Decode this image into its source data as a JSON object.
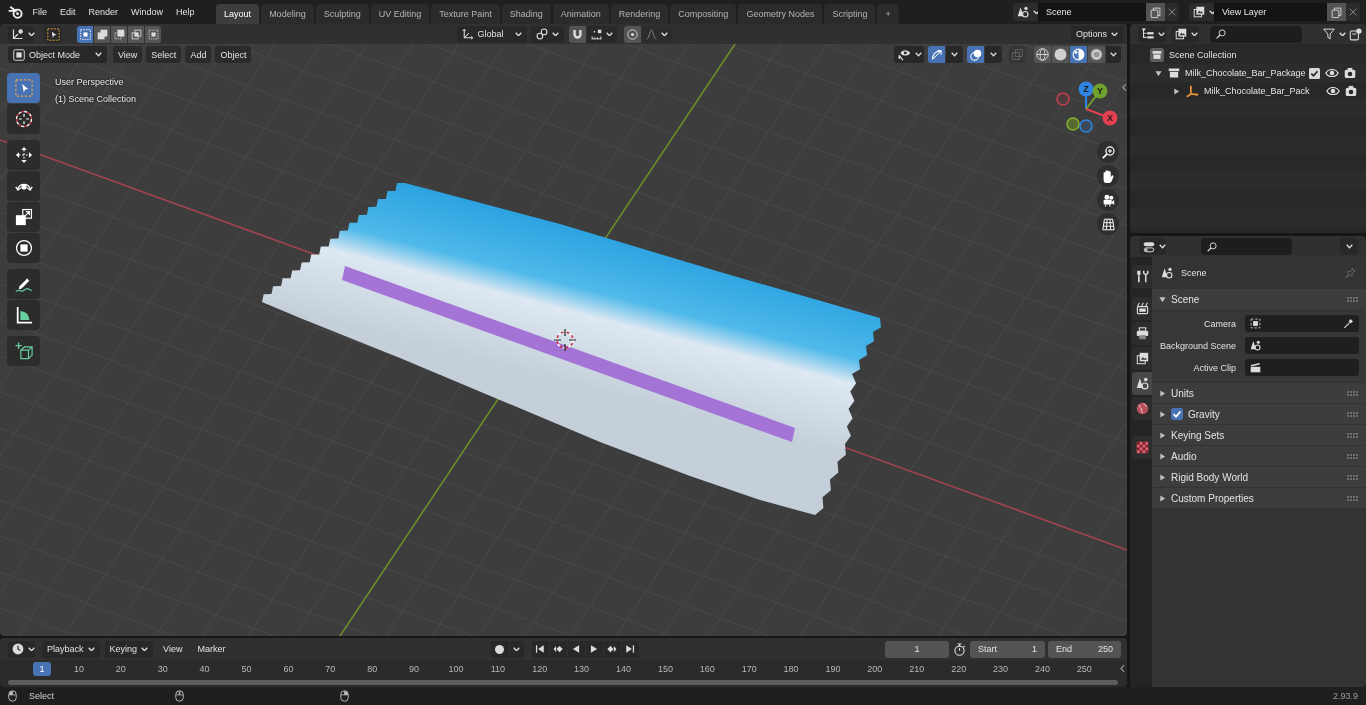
{
  "topbar": {
    "menus": [
      "File",
      "Edit",
      "Render",
      "Window",
      "Help"
    ],
    "workspaces": [
      {
        "label": "Layout",
        "selected": true
      },
      {
        "label": "Modeling",
        "selected": false
      },
      {
        "label": "Sculpting",
        "selected": false
      },
      {
        "label": "UV Editing",
        "selected": false
      },
      {
        "label": "Texture Paint",
        "selected": false
      },
      {
        "label": "Shading",
        "selected": false
      },
      {
        "label": "Animation",
        "selected": false
      },
      {
        "label": "Rendering",
        "selected": false
      },
      {
        "label": "Compositing",
        "selected": false
      },
      {
        "label": "Geometry Nodes",
        "selected": false
      },
      {
        "label": "Scripting",
        "selected": false
      }
    ],
    "add_workspace": "+",
    "scene": {
      "value": "Scene"
    },
    "view_layer": {
      "value": "View Layer"
    }
  },
  "tool_header": {
    "select_modes": [
      {
        "kind": "set",
        "selected": true
      },
      {
        "kind": "extend",
        "selected": false
      },
      {
        "kind": "subtract",
        "selected": false
      },
      {
        "kind": "invert",
        "selected": false
      },
      {
        "kind": "intersect",
        "selected": false
      }
    ],
    "orientation": "Global",
    "options": "Options"
  },
  "viewport_header": {
    "mode": "Object Mode",
    "menus": [
      "View",
      "Select",
      "Add",
      "Object"
    ],
    "gizmos": true,
    "overlays": true,
    "xray": false,
    "shading": [
      {
        "kind": "wireframe",
        "selected": false
      },
      {
        "kind": "solid",
        "selected": false
      },
      {
        "kind": "material",
        "selected": true
      },
      {
        "kind": "rendered",
        "selected": false
      }
    ]
  },
  "toolbar": {
    "groups": [
      {
        "tools": [
          {
            "kind": "select-box",
            "selected": true
          },
          {
            "kind": "cursor",
            "selected": false
          }
        ]
      },
      {
        "tools": [
          {
            "kind": "move",
            "selected": false
          },
          {
            "kind": "rotate",
            "selected": false
          },
          {
            "kind": "scale",
            "selected": false
          },
          {
            "kind": "transform",
            "selected": false
          }
        ]
      },
      {
        "tools": [
          {
            "kind": "annotate",
            "selected": false
          },
          {
            "kind": "measure",
            "selected": false
          }
        ]
      },
      {
        "tools": [
          {
            "kind": "add-cube",
            "selected": false
          }
        ]
      }
    ]
  },
  "viewport": {
    "overlay_text": [
      "User Perspective",
      "(1) Scene Collection"
    ],
    "gizmo_axes": [
      {
        "kind": "z",
        "label": "Z"
      },
      {
        "kind": "y",
        "label": "Y"
      },
      {
        "kind": "x",
        "label": "X"
      }
    ]
  },
  "outliner": {
    "tree": [
      {
        "label": "Scene Collection",
        "kind": "scene-collection",
        "selected": false,
        "children": [
          {
            "label": "Milk_Chocolate_Bar_Package",
            "kind": "collection",
            "selected": false,
            "expanded": true,
            "checked": true,
            "visible": true,
            "renderable": true,
            "children": [
              {
                "label": "Milk_Chocolate_Bar_Pack",
                "kind": "empty",
                "selected": false,
                "expanded": false,
                "visible": true,
                "renderable": true
              }
            ]
          }
        ]
      }
    ]
  },
  "properties": {
    "tab_groups": [
      {
        "tabs": [
          {
            "kind": "tool",
            "selected": false
          }
        ]
      },
      {
        "tabs": [
          {
            "kind": "render",
            "selected": false
          },
          {
            "kind": "output",
            "selected": false
          },
          {
            "kind": "view-layer",
            "selected": false
          },
          {
            "kind": "scene",
            "selected": true
          },
          {
            "kind": "world",
            "selected": false
          }
        ]
      },
      {
        "tabs": [
          {
            "kind": "texture",
            "selected": false
          }
        ]
      }
    ],
    "context": "Scene",
    "panels": [
      {
        "title": "Scene",
        "expanded": true,
        "fields": [
          {
            "label": "Camera",
            "kind": "camera"
          },
          {
            "label": "Background Scene",
            "kind": "scene"
          },
          {
            "label": "Active Clip",
            "kind": "clip"
          }
        ]
      },
      {
        "title": "Units",
        "expanded": false
      },
      {
        "title": "Gravity",
        "expanded": false,
        "checked": true
      },
      {
        "title": "Keying Sets",
        "expanded": false
      },
      {
        "title": "Audio",
        "expanded": false
      },
      {
        "title": "Rigid Body World",
        "expanded": false
      },
      {
        "title": "Custom Properties",
        "expanded": false
      }
    ]
  },
  "timeline": {
    "menus": [
      {
        "label": "Playback",
        "dropdown": true
      },
      {
        "label": "Keying",
        "dropdown": true
      },
      {
        "label": "View",
        "dropdown": false
      },
      {
        "label": "Marker",
        "dropdown": false
      }
    ],
    "current_frame": "1",
    "start": {
      "label": "Start",
      "value": "1"
    },
    "end": {
      "label": "End",
      "value": "250"
    },
    "ruler": {
      "playhead": "1",
      "marks": [
        "10",
        "20",
        "30",
        "40",
        "50",
        "60",
        "70",
        "80",
        "90",
        "100",
        "110",
        "120",
        "130",
        "140",
        "150",
        "160",
        "170",
        "180",
        "190",
        "200",
        "210",
        "220",
        "230",
        "240",
        "250"
      ]
    }
  },
  "status_bar": {
    "hints": [
      "Select"
    ],
    "version": "2.93.9"
  }
}
